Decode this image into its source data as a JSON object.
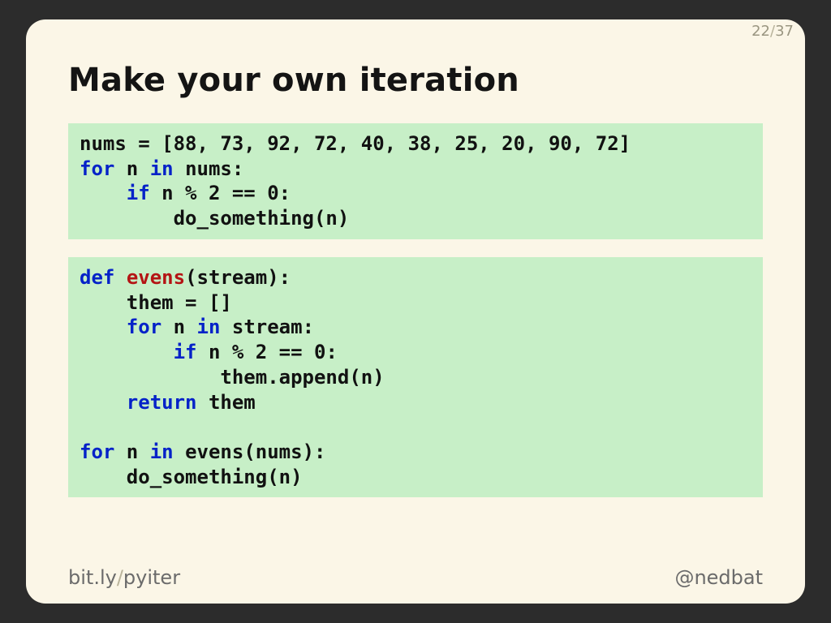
{
  "counter": {
    "current": "22",
    "total": "37"
  },
  "title": "Make your own iteration",
  "code1": {
    "l1a": "nums = [88, 73, 92, 72, 40, 38, 25, 20, 90, 72]",
    "l2_for": "for",
    "l2_mid": " n ",
    "l2_in": "in",
    "l2_end": " nums:",
    "l3_if": "if",
    "l3_rest": " n % 2 == 0:",
    "l4": "        do_something(n)"
  },
  "code2": {
    "l1_def": "def",
    "l1_sp": " ",
    "l1_fn": "evens",
    "l1_rest": "(stream):",
    "l2": "    them = []",
    "l3_pad": "    ",
    "l3_for": "for",
    "l3_mid": " n ",
    "l3_in": "in",
    "l3_end": " stream:",
    "l4_pad": "        ",
    "l4_if": "if",
    "l4_rest": " n % 2 == 0:",
    "l5": "            them.append(n)",
    "l6_pad": "    ",
    "l6_ret": "return",
    "l6_end": " them",
    "blank": "",
    "l8_for": "for",
    "l8_mid": " n ",
    "l8_in": "in",
    "l8_end": " evens(nums):",
    "l9": "    do_something(n)"
  },
  "footer": {
    "link_a": "bit.ly",
    "link_slash": "/",
    "link_b": "pyiter",
    "handle": "@nedbat"
  }
}
